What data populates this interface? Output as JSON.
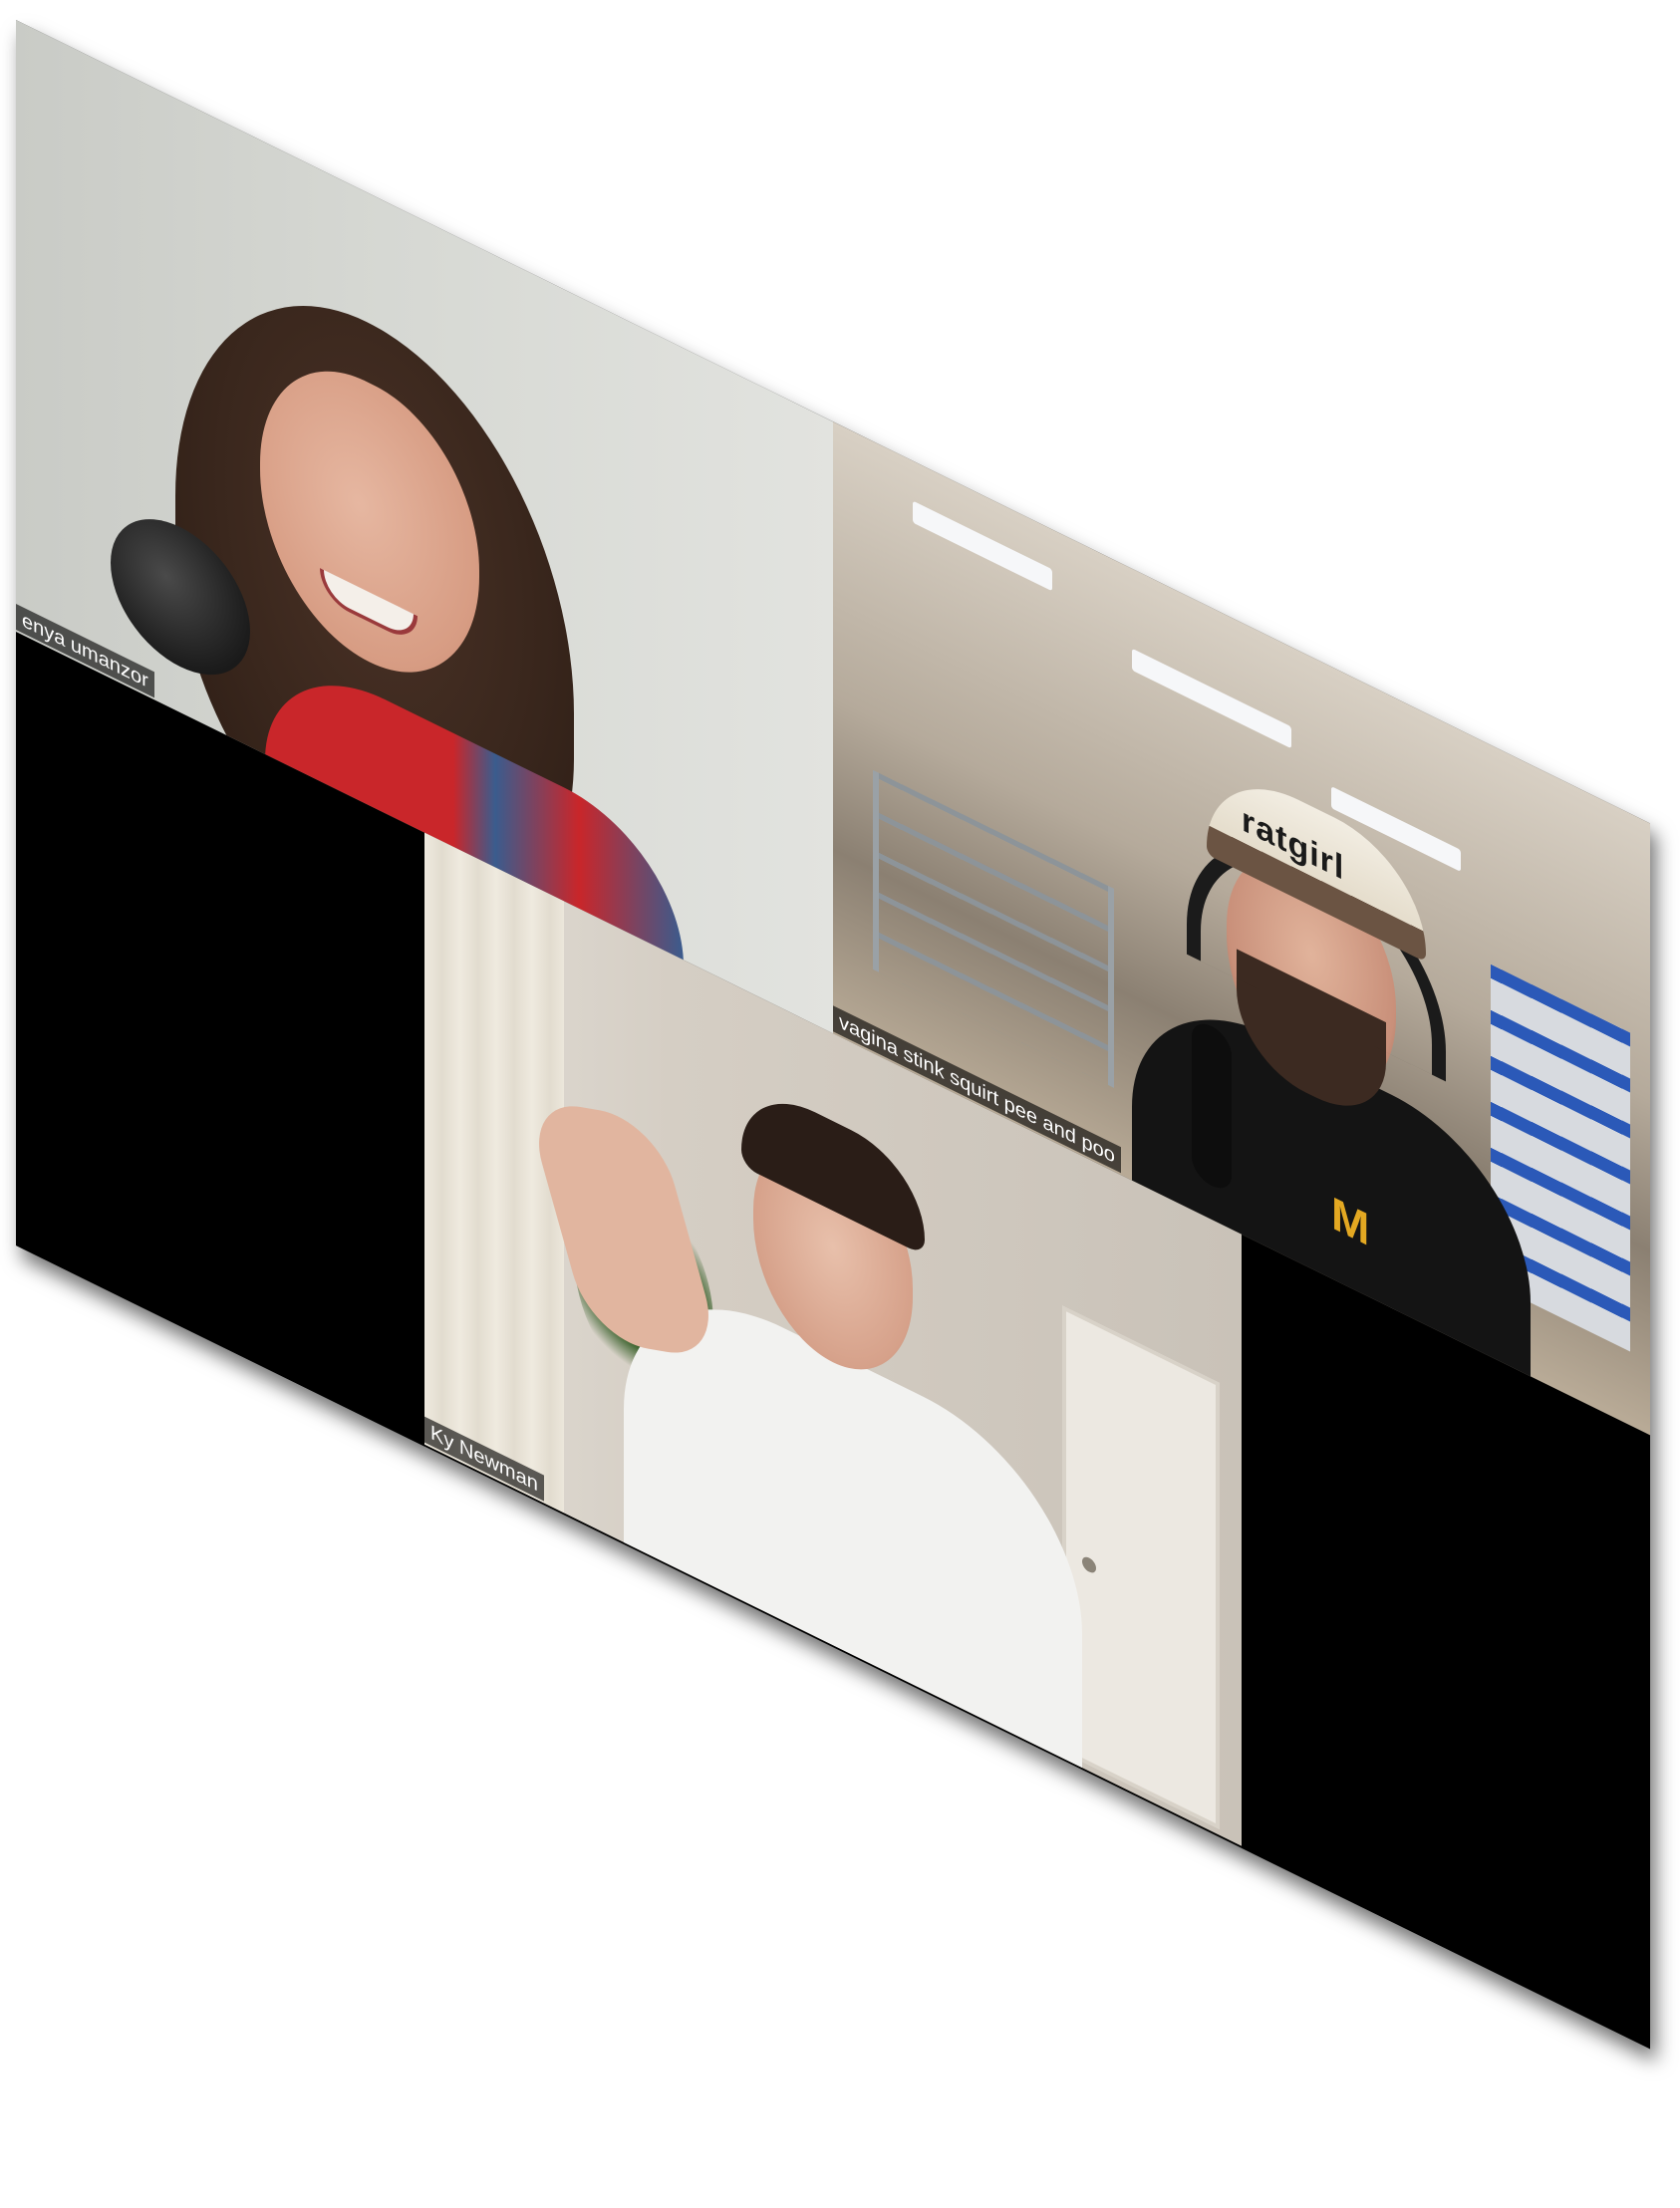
{
  "participants": [
    {
      "name": "enya umanzor"
    },
    {
      "name": "vagina stink squirt pee and poo"
    },
    {
      "name": "Ky Newman"
    }
  ],
  "participant_2_cap_text": "ratgirl",
  "participant_2_shirt_logo": "M",
  "colors": {
    "background": "#ffffff",
    "empty_tile": "#000000",
    "label_background": "#000000",
    "label_text": "#ffffff"
  }
}
